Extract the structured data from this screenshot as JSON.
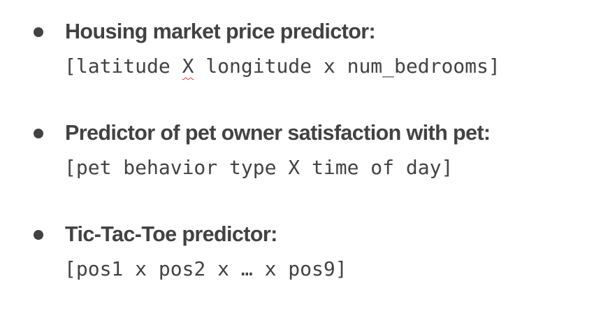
{
  "items": [
    {
      "title": "Housing market price predictor:",
      "feature_cross": {
        "open": "[latitude ",
        "cross": "X",
        "rest": " longitude x num_bedrooms]"
      }
    },
    {
      "title": "Predictor of pet owner satisfaction with pet:",
      "feature_cross": "[pet behavior type X time of day]"
    },
    {
      "title": "Tic-Tac-Toe predictor:",
      "feature_cross": "[pos1 x pos2 x … x pos9]"
    }
  ]
}
